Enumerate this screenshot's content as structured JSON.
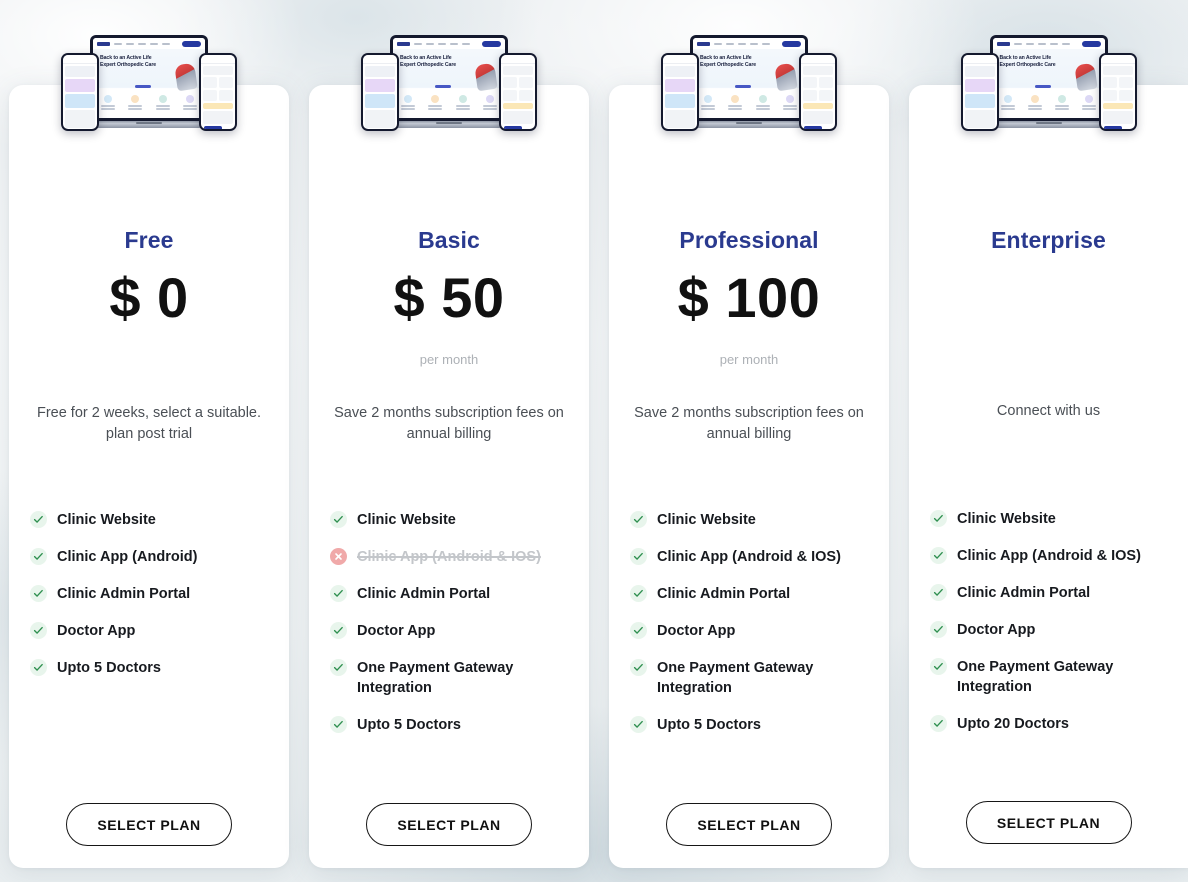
{
  "page": {
    "background_color": "#f3f5f6",
    "accent_color": "#2a3a8f",
    "price_color": "#111111",
    "check_color": "#2e8f4f",
    "cross_color": "#f0a9a9"
  },
  "mockup": {
    "hero_line1": "Back to an Active Life",
    "hero_line2": "Expert Orthopedic Care"
  },
  "plans": [
    {
      "name": "Free",
      "price": "$ 0",
      "period": "",
      "blurb": "Free for 2 weeks, select a suitable. plan post trial",
      "cta": "SELECT PLAN",
      "features": [
        {
          "label": "Clinic Website",
          "included": true
        },
        {
          "label": "Clinic App (Android)",
          "included": true
        },
        {
          "label": "Clinic Admin Portal",
          "included": true
        },
        {
          "label": "Doctor App",
          "included": true
        },
        {
          "label": "Upto 5 Doctors",
          "included": true
        }
      ]
    },
    {
      "name": "Basic",
      "price": "$ 50",
      "period": "per month",
      "blurb": "Save 2 months subscription fees on annual billing",
      "cta": "SELECT PLAN",
      "features": [
        {
          "label": "Clinic Website",
          "included": true
        },
        {
          "label": "Clinic App (Android & IOS)",
          "included": false
        },
        {
          "label": "Clinic Admin Portal",
          "included": true
        },
        {
          "label": "Doctor App",
          "included": true
        },
        {
          "label": "One Payment Gateway Integration",
          "included": true
        },
        {
          "label": "Upto 5 Doctors",
          "included": true
        }
      ]
    },
    {
      "name": "Professional",
      "price": "$ 100",
      "period": "per month",
      "blurb": "Save 2 months subscription fees on annual billing",
      "cta": "SELECT PLAN",
      "features": [
        {
          "label": "Clinic Website",
          "included": true
        },
        {
          "label": "Clinic App (Android & IOS)",
          "included": true
        },
        {
          "label": "Clinic Admin Portal",
          "included": true
        },
        {
          "label": "Doctor App",
          "included": true
        },
        {
          "label": "One Payment Gateway Integration",
          "included": true
        },
        {
          "label": "Upto 5 Doctors",
          "included": true
        }
      ]
    },
    {
      "name": "Enterprise",
      "price": "",
      "period": "",
      "blurb": "Connect with us",
      "cta": "SELECT PLAN",
      "features": [
        {
          "label": "Clinic Website",
          "included": true
        },
        {
          "label": "Clinic App (Android & IOS)",
          "included": true
        },
        {
          "label": "Clinic Admin Portal",
          "included": true
        },
        {
          "label": "Doctor App",
          "included": true
        },
        {
          "label": "One Payment Gateway Integration",
          "included": true
        },
        {
          "label": "Upto 20 Doctors",
          "included": true
        }
      ]
    }
  ]
}
